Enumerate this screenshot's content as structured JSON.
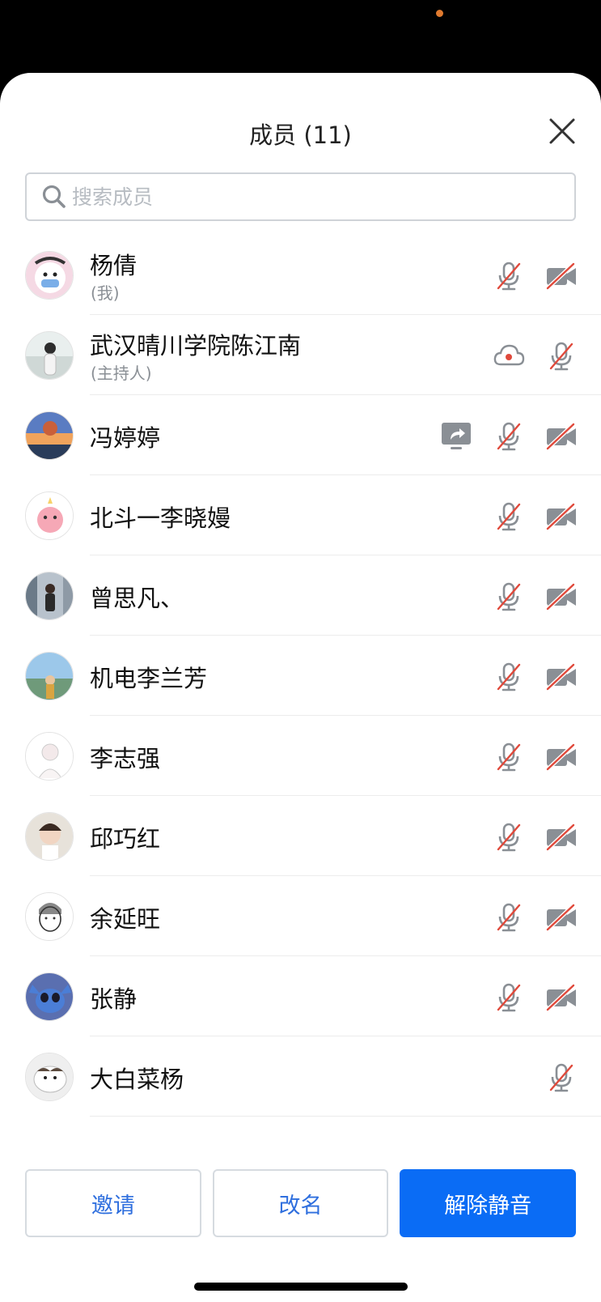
{
  "header": {
    "title": "成员 (11)"
  },
  "search": {
    "placeholder": "搜索成员"
  },
  "members": [
    {
      "name": "杨倩",
      "sub": "(我)",
      "icons": [
        "mic-muted-icon",
        "camera-off-icon"
      ]
    },
    {
      "name": "武汉晴川学院陈江南",
      "sub": "(主持人)",
      "icons": [
        "cloud-recording-icon",
        "mic-muted-icon"
      ]
    },
    {
      "name": "冯婷婷",
      "sub": "",
      "icons": [
        "screen-share-icon",
        "mic-muted-icon",
        "camera-off-icon"
      ]
    },
    {
      "name": "北斗一李晓嫚",
      "sub": "",
      "icons": [
        "mic-muted-icon",
        "camera-off-icon"
      ]
    },
    {
      "name": "曾思凡、",
      "sub": "",
      "icons": [
        "mic-muted-icon",
        "camera-off-icon"
      ]
    },
    {
      "name": "机电李兰芳",
      "sub": "",
      "icons": [
        "mic-muted-icon",
        "camera-off-icon"
      ]
    },
    {
      "name": "李志强",
      "sub": "",
      "icons": [
        "mic-muted-icon",
        "camera-off-icon"
      ]
    },
    {
      "name": "邱巧红",
      "sub": "",
      "icons": [
        "mic-muted-icon",
        "camera-off-icon"
      ]
    },
    {
      "name": "余延旺",
      "sub": "",
      "icons": [
        "mic-muted-icon",
        "camera-off-icon"
      ]
    },
    {
      "name": "张静",
      "sub": "",
      "icons": [
        "mic-muted-icon",
        "camera-off-icon"
      ]
    },
    {
      "name": "大白菜杨",
      "sub": "",
      "icons": [
        "mic-muted-icon"
      ]
    }
  ],
  "buttons": {
    "invite": "邀请",
    "rename": "改名",
    "unmute": "解除静音"
  },
  "colors": {
    "accent": "#0a6cf5",
    "muted_red": "#e0493b",
    "icon_gray": "#8a8f95"
  }
}
